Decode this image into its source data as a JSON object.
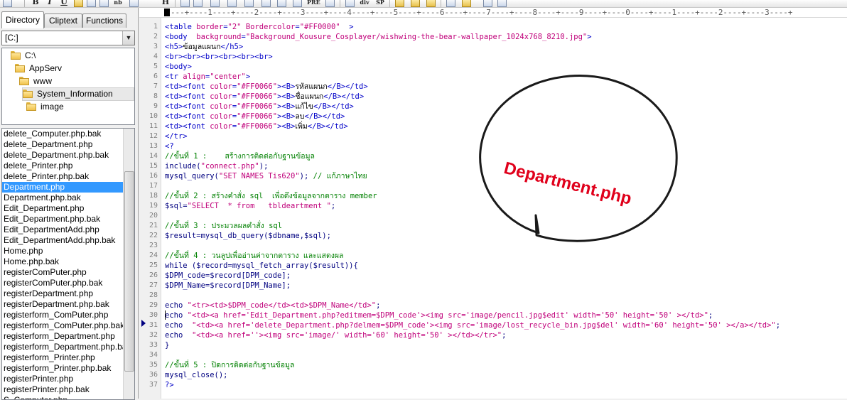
{
  "toolbar": {
    "bold": "B",
    "italic": "I",
    "underline": "U",
    "nbsp": "nb",
    "hr": "H",
    "pre": "PRE",
    "div": "div",
    "sp": "SP"
  },
  "left_panel": {
    "tabs": [
      {
        "label": "Directory",
        "active": true
      },
      {
        "label": "Cliptext",
        "active": false
      },
      {
        "label": "Functions",
        "active": false
      }
    ],
    "drive": "[C:]",
    "tree": [
      {
        "label": "C:\\",
        "selected": false
      },
      {
        "label": "AppServ",
        "selected": false
      },
      {
        "label": "www",
        "selected": false
      },
      {
        "label": "System_Information",
        "selected": true
      },
      {
        "label": "image",
        "selected": false
      }
    ],
    "files": [
      "delete_Computer.php.bak",
      "delete_Department.php",
      "delete_Department.php.bak",
      "delete_Printer.php",
      "delete_Printer.php.bak",
      "Department.php",
      "Department.php.bak",
      "Edit_Department.php",
      "Edit_Department.php.bak",
      "Edit_DepartmentAdd.php",
      "Edit_DepartmentAdd.php.bak",
      "Home.php",
      "Home.php.bak",
      "registerComPuter.php",
      "registerComPuter.php.bak",
      "registerDepartment.php",
      "registerDepartment.php.bak",
      "registerform_ComPuter.php",
      "registerform_ComPuter.php.bak",
      "registerform_Department.php",
      "registerform_Department.php.bak",
      "registerform_Printer.php",
      "registerform_Printer.php.bak",
      "registerPrinter.php",
      "registerPrinter.php.bak",
      "S_Computer.php"
    ],
    "selected_file": "Department.php"
  },
  "editor": {
    "ruler": "---+----1----+----2----+----3----+----4----+----5----+----6----+----7----+----8----+----9----+----0----+----1----+----2----+----3----+",
    "line_numbers": [
      "1",
      "2",
      "3",
      "4",
      "5",
      "6",
      "7",
      "8",
      "9",
      "10",
      "11",
      "12",
      "13",
      "14",
      "15",
      "16",
      "17",
      "18",
      "19",
      "20",
      "21",
      "22",
      "23",
      "24",
      "25",
      "26",
      "27",
      "28",
      "29",
      "30",
      "31",
      "32",
      "33",
      "34",
      "35",
      "36",
      "37"
    ],
    "bookmark_line": "30",
    "lines": [
      {
        "n": 1,
        "parts": [
          {
            "c": "tg",
            "t": "<table "
          },
          {
            "c": "at",
            "t": "border"
          },
          {
            "c": "tg",
            "t": "="
          },
          {
            "c": "st",
            "t": "\"2\""
          },
          {
            "c": "tg",
            "t": " "
          },
          {
            "c": "at",
            "t": "Bordercolor"
          },
          {
            "c": "tg",
            "t": "="
          },
          {
            "c": "st",
            "t": "\"#FF0000\""
          },
          {
            "c": "tg",
            "t": "  >"
          }
        ]
      },
      {
        "n": 2,
        "parts": [
          {
            "c": "tg",
            "t": "<body  "
          },
          {
            "c": "at",
            "t": "background"
          },
          {
            "c": "tg",
            "t": "="
          },
          {
            "c": "st",
            "t": "\"Background_Kousure_Cosplayer/wishwing-the-bear-wallpaper_1024x768_8210.jpg\""
          },
          {
            "c": "tg",
            "t": ">"
          }
        ]
      },
      {
        "n": 3,
        "parts": [
          {
            "c": "tg",
            "t": "<h5>"
          },
          {
            "c": "pl",
            "t": "ข้อมูลแผนก"
          },
          {
            "c": "tg",
            "t": "</h5>"
          }
        ]
      },
      {
        "n": 4,
        "parts": [
          {
            "c": "tg",
            "t": "<br><br><br><br><br><br>"
          }
        ]
      },
      {
        "n": 5,
        "parts": [
          {
            "c": "tg",
            "t": "<body>"
          }
        ]
      },
      {
        "n": 6,
        "parts": [
          {
            "c": "tg",
            "t": "<tr "
          },
          {
            "c": "at",
            "t": "align"
          },
          {
            "c": "tg",
            "t": "="
          },
          {
            "c": "st",
            "t": "\"center\""
          },
          {
            "c": "tg",
            "t": ">"
          }
        ]
      },
      {
        "n": 7,
        "parts": [
          {
            "c": "tg",
            "t": "<td><font "
          },
          {
            "c": "at",
            "t": "color"
          },
          {
            "c": "tg",
            "t": "="
          },
          {
            "c": "st",
            "t": "\"#FF0066\""
          },
          {
            "c": "tg",
            "t": "><B>"
          },
          {
            "c": "pl",
            "t": "รหัสแผนก"
          },
          {
            "c": "tg",
            "t": "</B></td>"
          }
        ]
      },
      {
        "n": 8,
        "parts": [
          {
            "c": "tg",
            "t": "<td><font "
          },
          {
            "c": "at",
            "t": "color"
          },
          {
            "c": "tg",
            "t": "="
          },
          {
            "c": "st",
            "t": "\"#FF0066\""
          },
          {
            "c": "tg",
            "t": "><B>"
          },
          {
            "c": "pl",
            "t": "ชื่อแผนก"
          },
          {
            "c": "tg",
            "t": "</B></td>"
          }
        ]
      },
      {
        "n": 9,
        "parts": [
          {
            "c": "tg",
            "t": "<td><font "
          },
          {
            "c": "at",
            "t": "color"
          },
          {
            "c": "tg",
            "t": "="
          },
          {
            "c": "st",
            "t": "\"#FF0066\""
          },
          {
            "c": "tg",
            "t": "><B>"
          },
          {
            "c": "pl",
            "t": "แก้ไข"
          },
          {
            "c": "tg",
            "t": "</B></td>"
          }
        ]
      },
      {
        "n": 10,
        "parts": [
          {
            "c": "tg",
            "t": "<td><font "
          },
          {
            "c": "at",
            "t": "color"
          },
          {
            "c": "tg",
            "t": "="
          },
          {
            "c": "st",
            "t": "\"#FF0066\""
          },
          {
            "c": "tg",
            "t": "><B>"
          },
          {
            "c": "pl",
            "t": "ลบ"
          },
          {
            "c": "tg",
            "t": "</B></td>"
          }
        ]
      },
      {
        "n": 11,
        "parts": [
          {
            "c": "tg",
            "t": "<td><font "
          },
          {
            "c": "at",
            "t": "color"
          },
          {
            "c": "tg",
            "t": "="
          },
          {
            "c": "st",
            "t": "\"#FF0066\""
          },
          {
            "c": "tg",
            "t": "><B>"
          },
          {
            "c": "pl",
            "t": "เพิ่ม"
          },
          {
            "c": "tg",
            "t": "</B></td>"
          }
        ]
      },
      {
        "n": 12,
        "parts": [
          {
            "c": "tg",
            "t": "</tr>"
          }
        ]
      },
      {
        "n": 13,
        "parts": [
          {
            "c": "tg",
            "t": "<?"
          }
        ]
      },
      {
        "n": 14,
        "parts": [
          {
            "c": "cm",
            "t": "//ขั้นที่ 1 :    สร้างการติดต่อกับฐานข้อมูล"
          }
        ]
      },
      {
        "n": 15,
        "parts": [
          {
            "c": "vr",
            "t": "include("
          },
          {
            "c": "st",
            "t": "\"connect.php\""
          },
          {
            "c": "vr",
            "t": ");"
          }
        ]
      },
      {
        "n": 16,
        "parts": [
          {
            "c": "vr",
            "t": "mysql_query("
          },
          {
            "c": "st",
            "t": "\"SET NAMES Tis620\""
          },
          {
            "c": "vr",
            "t": "); "
          },
          {
            "c": "cm",
            "t": "// แก้ภาษาไทย"
          }
        ]
      },
      {
        "n": 17,
        "parts": []
      },
      {
        "n": 18,
        "parts": [
          {
            "c": "cm",
            "t": "//ขั้นที่ 2 : สร้างคำสั่ง sql  เพื่อดึงข้อมูลจากตาราง member"
          }
        ]
      },
      {
        "n": 19,
        "parts": [
          {
            "c": "vr",
            "t": "$sql="
          },
          {
            "c": "st",
            "t": "\"SELECT  * from   tbldeartment \""
          },
          {
            "c": "vr",
            "t": ";"
          }
        ]
      },
      {
        "n": 20,
        "parts": []
      },
      {
        "n": 21,
        "parts": [
          {
            "c": "cm",
            "t": "//ขั้นที่ 3 : ประมวลผลคำสั่ง sql"
          }
        ]
      },
      {
        "n": 22,
        "parts": [
          {
            "c": "vr",
            "t": "$result=mysql_db_query($dbname,$sql);"
          }
        ]
      },
      {
        "n": 23,
        "parts": []
      },
      {
        "n": 24,
        "parts": [
          {
            "c": "cm",
            "t": "//ขั้นที่ 4 : วนลูปเพื่ออ่านค่าจากตาราง และแสดงผล"
          }
        ]
      },
      {
        "n": 25,
        "parts": [
          {
            "c": "vr",
            "t": "while ($record=mysql_fetch_array($result)){"
          }
        ]
      },
      {
        "n": 26,
        "parts": [
          {
            "c": "vr",
            "t": "$DPM_code=$record[DPM_code];"
          }
        ]
      },
      {
        "n": 27,
        "parts": [
          {
            "c": "vr",
            "t": "$DPM_Name=$record[DPM_Name];"
          }
        ]
      },
      {
        "n": 28,
        "parts": []
      },
      {
        "n": 29,
        "parts": [
          {
            "c": "vr",
            "t": "echo "
          },
          {
            "c": "st",
            "t": "\"<tr><td>$DPM_code</td><td>$DPM_Name</td>\""
          },
          {
            "c": "vr",
            "t": ";"
          }
        ]
      },
      {
        "n": 30,
        "parts": [
          {
            "c": "vr",
            "t": "echo "
          },
          {
            "c": "st",
            "t": "\"<td><a href='Edit_Department.php?editmem=$DPM_code'><img src='image/pencil.jpg$edit' width='50' height='50' ></td>\""
          },
          {
            "c": "vr",
            "t": ";"
          }
        ]
      },
      {
        "n": 31,
        "parts": [
          {
            "c": "vr",
            "t": "echo  "
          },
          {
            "c": "st",
            "t": "\"<td><a href='delete_Department.php?delmem=$DPM_code'><img src='image/lost_recycle_bin.jpg$del' width='60' height='50' ></a></td>\""
          },
          {
            "c": "vr",
            "t": ";"
          }
        ]
      },
      {
        "n": 32,
        "parts": [
          {
            "c": "vr",
            "t": "echo  "
          },
          {
            "c": "st",
            "t": "\"<td><a href=''><img src='image/' width='60' height='50' ></td></tr>\""
          },
          {
            "c": "vr",
            "t": ";"
          }
        ]
      },
      {
        "n": 33,
        "parts": [
          {
            "c": "vr",
            "t": "}"
          }
        ]
      },
      {
        "n": 34,
        "parts": []
      },
      {
        "n": 35,
        "parts": [
          {
            "c": "cm",
            "t": "//ขั้นที่ 5 : ปิดการติดต่อกับฐานข้อมูล"
          }
        ]
      },
      {
        "n": 36,
        "parts": [
          {
            "c": "vr",
            "t": "mysql_close();"
          }
        ]
      },
      {
        "n": 37,
        "parts": [
          {
            "c": "tg",
            "t": "?>"
          }
        ]
      }
    ]
  },
  "annotation": {
    "text": "Department.php",
    "color": "#e0001b"
  }
}
